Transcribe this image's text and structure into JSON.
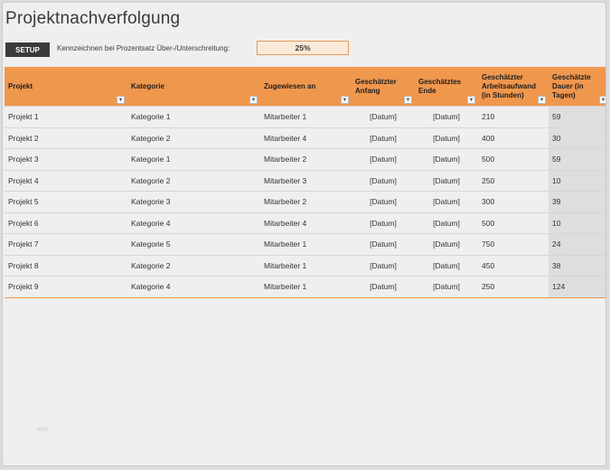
{
  "title": "Projektnachverfolgung",
  "setup_button": "SETUP",
  "flag_label": "Kennzeichnen bei Prozentsatz Über-/Unterschreitung:",
  "flag_value": "25%",
  "watermark": "xlsx",
  "columns": [
    "Projekt",
    "Kategorie",
    "Zugewiesen an",
    "Geschätzter Anfang",
    "Geschätztes Ende",
    "Geschätzter Arbeitsaufwand (in Stunden)",
    "Geschätzte Dauer (in Tagen)"
  ],
  "filter_icon": "chevron-down-icon",
  "rows": [
    [
      "Projekt 1",
      "Kategorie 1",
      "Mitarbeiter 1",
      "[Datum]",
      "[Datum]",
      "210",
      "59"
    ],
    [
      "Projekt 2",
      "Kategorie 2",
      "Mitarbeiter 4",
      "[Datum]",
      "[Datum]",
      "400",
      "30"
    ],
    [
      "Projekt 3",
      "Kategorie 1",
      "Mitarbeiter 2",
      "[Datum]",
      "[Datum]",
      "500",
      "59"
    ],
    [
      "Projekt 4",
      "Kategorie 2",
      "Mitarbeiter 3",
      "[Datum]",
      "[Datum]",
      "250",
      "10"
    ],
    [
      "Projekt 5",
      "Kategorie 3",
      "Mitarbeiter 2",
      "[Datum]",
      "[Datum]",
      "300",
      "39"
    ],
    [
      "Projekt 6",
      "Kategorie 4",
      "Mitarbeiter 4",
      "[Datum]",
      "[Datum]",
      "500",
      "10"
    ],
    [
      "Projekt 7",
      "Kategorie 5",
      "Mitarbeiter 1",
      "[Datum]",
      "[Datum]",
      "750",
      "24"
    ],
    [
      "Projekt 8",
      "Kategorie 2",
      "Mitarbeiter 1",
      "[Datum]",
      "[Datum]",
      "450",
      "38"
    ],
    [
      "Projekt 9",
      "Kategorie 4",
      "Mitarbeiter 1",
      "[Datum]",
      "[Datum]",
      "250",
      "124"
    ]
  ],
  "colors": {
    "header": "#f0974e",
    "setup": "#3b3b3b",
    "input_border": "#e79b59",
    "input_fill": "#fbe9d8"
  }
}
